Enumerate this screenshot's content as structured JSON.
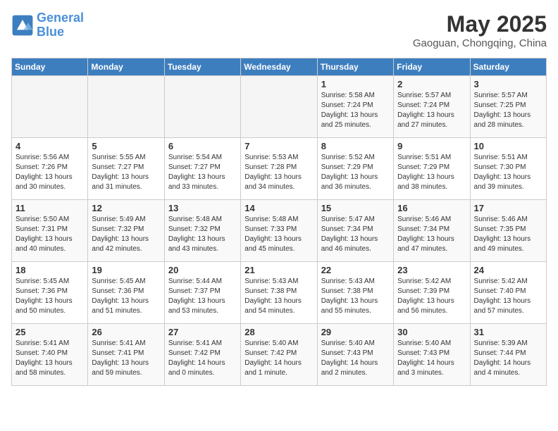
{
  "logo": {
    "line1": "General",
    "line2": "Blue"
  },
  "title": "May 2025",
  "location": "Gaoguan, Chongqing, China",
  "weekdays": [
    "Sunday",
    "Monday",
    "Tuesday",
    "Wednesday",
    "Thursday",
    "Friday",
    "Saturday"
  ],
  "weeks": [
    [
      {
        "day": "",
        "sunrise": "",
        "sunset": "",
        "daylight": ""
      },
      {
        "day": "",
        "sunrise": "",
        "sunset": "",
        "daylight": ""
      },
      {
        "day": "",
        "sunrise": "",
        "sunset": "",
        "daylight": ""
      },
      {
        "day": "",
        "sunrise": "",
        "sunset": "",
        "daylight": ""
      },
      {
        "day": "1",
        "sunrise": "Sunrise: 5:58 AM",
        "sunset": "Sunset: 7:24 PM",
        "daylight": "Daylight: 13 hours and 25 minutes."
      },
      {
        "day": "2",
        "sunrise": "Sunrise: 5:57 AM",
        "sunset": "Sunset: 7:24 PM",
        "daylight": "Daylight: 13 hours and 27 minutes."
      },
      {
        "day": "3",
        "sunrise": "Sunrise: 5:57 AM",
        "sunset": "Sunset: 7:25 PM",
        "daylight": "Daylight: 13 hours and 28 minutes."
      }
    ],
    [
      {
        "day": "4",
        "sunrise": "Sunrise: 5:56 AM",
        "sunset": "Sunset: 7:26 PM",
        "daylight": "Daylight: 13 hours and 30 minutes."
      },
      {
        "day": "5",
        "sunrise": "Sunrise: 5:55 AM",
        "sunset": "Sunset: 7:27 PM",
        "daylight": "Daylight: 13 hours and 31 minutes."
      },
      {
        "day": "6",
        "sunrise": "Sunrise: 5:54 AM",
        "sunset": "Sunset: 7:27 PM",
        "daylight": "Daylight: 13 hours and 33 minutes."
      },
      {
        "day": "7",
        "sunrise": "Sunrise: 5:53 AM",
        "sunset": "Sunset: 7:28 PM",
        "daylight": "Daylight: 13 hours and 34 minutes."
      },
      {
        "day": "8",
        "sunrise": "Sunrise: 5:52 AM",
        "sunset": "Sunset: 7:29 PM",
        "daylight": "Daylight: 13 hours and 36 minutes."
      },
      {
        "day": "9",
        "sunrise": "Sunrise: 5:51 AM",
        "sunset": "Sunset: 7:29 PM",
        "daylight": "Daylight: 13 hours and 38 minutes."
      },
      {
        "day": "10",
        "sunrise": "Sunrise: 5:51 AM",
        "sunset": "Sunset: 7:30 PM",
        "daylight": "Daylight: 13 hours and 39 minutes."
      }
    ],
    [
      {
        "day": "11",
        "sunrise": "Sunrise: 5:50 AM",
        "sunset": "Sunset: 7:31 PM",
        "daylight": "Daylight: 13 hours and 40 minutes."
      },
      {
        "day": "12",
        "sunrise": "Sunrise: 5:49 AM",
        "sunset": "Sunset: 7:32 PM",
        "daylight": "Daylight: 13 hours and 42 minutes."
      },
      {
        "day": "13",
        "sunrise": "Sunrise: 5:48 AM",
        "sunset": "Sunset: 7:32 PM",
        "daylight": "Daylight: 13 hours and 43 minutes."
      },
      {
        "day": "14",
        "sunrise": "Sunrise: 5:48 AM",
        "sunset": "Sunset: 7:33 PM",
        "daylight": "Daylight: 13 hours and 45 minutes."
      },
      {
        "day": "15",
        "sunrise": "Sunrise: 5:47 AM",
        "sunset": "Sunset: 7:34 PM",
        "daylight": "Daylight: 13 hours and 46 minutes."
      },
      {
        "day": "16",
        "sunrise": "Sunrise: 5:46 AM",
        "sunset": "Sunset: 7:34 PM",
        "daylight": "Daylight: 13 hours and 47 minutes."
      },
      {
        "day": "17",
        "sunrise": "Sunrise: 5:46 AM",
        "sunset": "Sunset: 7:35 PM",
        "daylight": "Daylight: 13 hours and 49 minutes."
      }
    ],
    [
      {
        "day": "18",
        "sunrise": "Sunrise: 5:45 AM",
        "sunset": "Sunset: 7:36 PM",
        "daylight": "Daylight: 13 hours and 50 minutes."
      },
      {
        "day": "19",
        "sunrise": "Sunrise: 5:45 AM",
        "sunset": "Sunset: 7:36 PM",
        "daylight": "Daylight: 13 hours and 51 minutes."
      },
      {
        "day": "20",
        "sunrise": "Sunrise: 5:44 AM",
        "sunset": "Sunset: 7:37 PM",
        "daylight": "Daylight: 13 hours and 53 minutes."
      },
      {
        "day": "21",
        "sunrise": "Sunrise: 5:43 AM",
        "sunset": "Sunset: 7:38 PM",
        "daylight": "Daylight: 13 hours and 54 minutes."
      },
      {
        "day": "22",
        "sunrise": "Sunrise: 5:43 AM",
        "sunset": "Sunset: 7:38 PM",
        "daylight": "Daylight: 13 hours and 55 minutes."
      },
      {
        "day": "23",
        "sunrise": "Sunrise: 5:42 AM",
        "sunset": "Sunset: 7:39 PM",
        "daylight": "Daylight: 13 hours and 56 minutes."
      },
      {
        "day": "24",
        "sunrise": "Sunrise: 5:42 AM",
        "sunset": "Sunset: 7:40 PM",
        "daylight": "Daylight: 13 hours and 57 minutes."
      }
    ],
    [
      {
        "day": "25",
        "sunrise": "Sunrise: 5:41 AM",
        "sunset": "Sunset: 7:40 PM",
        "daylight": "Daylight: 13 hours and 58 minutes."
      },
      {
        "day": "26",
        "sunrise": "Sunrise: 5:41 AM",
        "sunset": "Sunset: 7:41 PM",
        "daylight": "Daylight: 13 hours and 59 minutes."
      },
      {
        "day": "27",
        "sunrise": "Sunrise: 5:41 AM",
        "sunset": "Sunset: 7:42 PM",
        "daylight": "Daylight: 14 hours and 0 minutes."
      },
      {
        "day": "28",
        "sunrise": "Sunrise: 5:40 AM",
        "sunset": "Sunset: 7:42 PM",
        "daylight": "Daylight: 14 hours and 1 minute."
      },
      {
        "day": "29",
        "sunrise": "Sunrise: 5:40 AM",
        "sunset": "Sunset: 7:43 PM",
        "daylight": "Daylight: 14 hours and 2 minutes."
      },
      {
        "day": "30",
        "sunrise": "Sunrise: 5:40 AM",
        "sunset": "Sunset: 7:43 PM",
        "daylight": "Daylight: 14 hours and 3 minutes."
      },
      {
        "day": "31",
        "sunrise": "Sunrise: 5:39 AM",
        "sunset": "Sunset: 7:44 PM",
        "daylight": "Daylight: 14 hours and 4 minutes."
      }
    ]
  ]
}
